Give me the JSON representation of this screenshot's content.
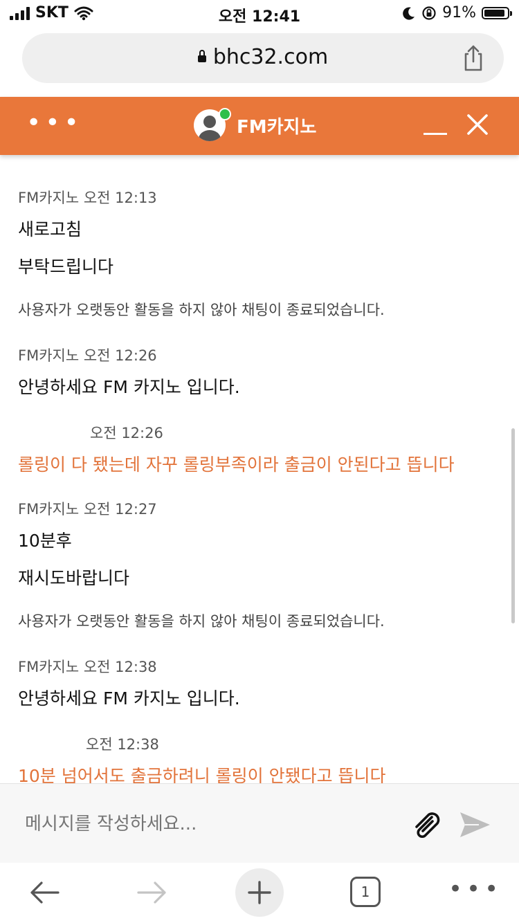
{
  "status_bar": {
    "carrier": "SKT",
    "time": "오전 12:41",
    "battery": "91%",
    "battery_level": 0.91
  },
  "browser": {
    "url": "bhc32.com"
  },
  "chat_header": {
    "title": "FM카지노"
  },
  "messages": [
    {
      "type": "agent",
      "sender": "FM카지노 오전 12:13",
      "lines": [
        "새로고침",
        "부탁드립니다"
      ]
    },
    {
      "type": "system",
      "text": "사용자가 오랫동안 활동을 하지 않아 채팅이 종료되었습니다."
    },
    {
      "type": "agent",
      "sender": "FM카지노 오전 12:26",
      "lines": [
        "안녕하세요 FM 카지노 입니다."
      ]
    },
    {
      "type": "user",
      "sender": "오전 12:26",
      "lines": [
        "롤링이 다 됐는데 자꾸 롤링부족이라 출금이 안된다고 뜹니다"
      ]
    },
    {
      "type": "agent",
      "sender": "FM카지노 오전 12:27",
      "lines": [
        "10분후",
        "재시도바랍니다"
      ]
    },
    {
      "type": "system",
      "text": "사용자가 오랫동안 활동을 하지 않아 채팅이 종료되었습니다."
    },
    {
      "type": "agent",
      "sender": "FM카지노 오전 12:38",
      "lines": [
        "안녕하세요 FM 카지노 입니다."
      ]
    },
    {
      "type": "user",
      "sender": "오전 12:38",
      "lines": [
        "10분 넘어서도 출금하려니 롤링이 안됐다고 뜹니다"
      ]
    }
  ],
  "input": {
    "placeholder": "메시지를 작성하세요..."
  },
  "toolbar": {
    "tab_count": "1"
  },
  "colors": {
    "accent": "#e9773a",
    "user_text": "#e2733a",
    "online": "#2fbf4a"
  },
  "icons": [
    "wifi-icon",
    "moon-icon",
    "orientation-lock-icon",
    "lock-icon",
    "share-icon",
    "more-icon",
    "avatar-icon",
    "minimize-icon",
    "close-icon",
    "attach-icon",
    "send-icon",
    "back-icon",
    "forward-icon",
    "new-tab-icon",
    "tabs-icon",
    "more-menu-icon"
  ]
}
